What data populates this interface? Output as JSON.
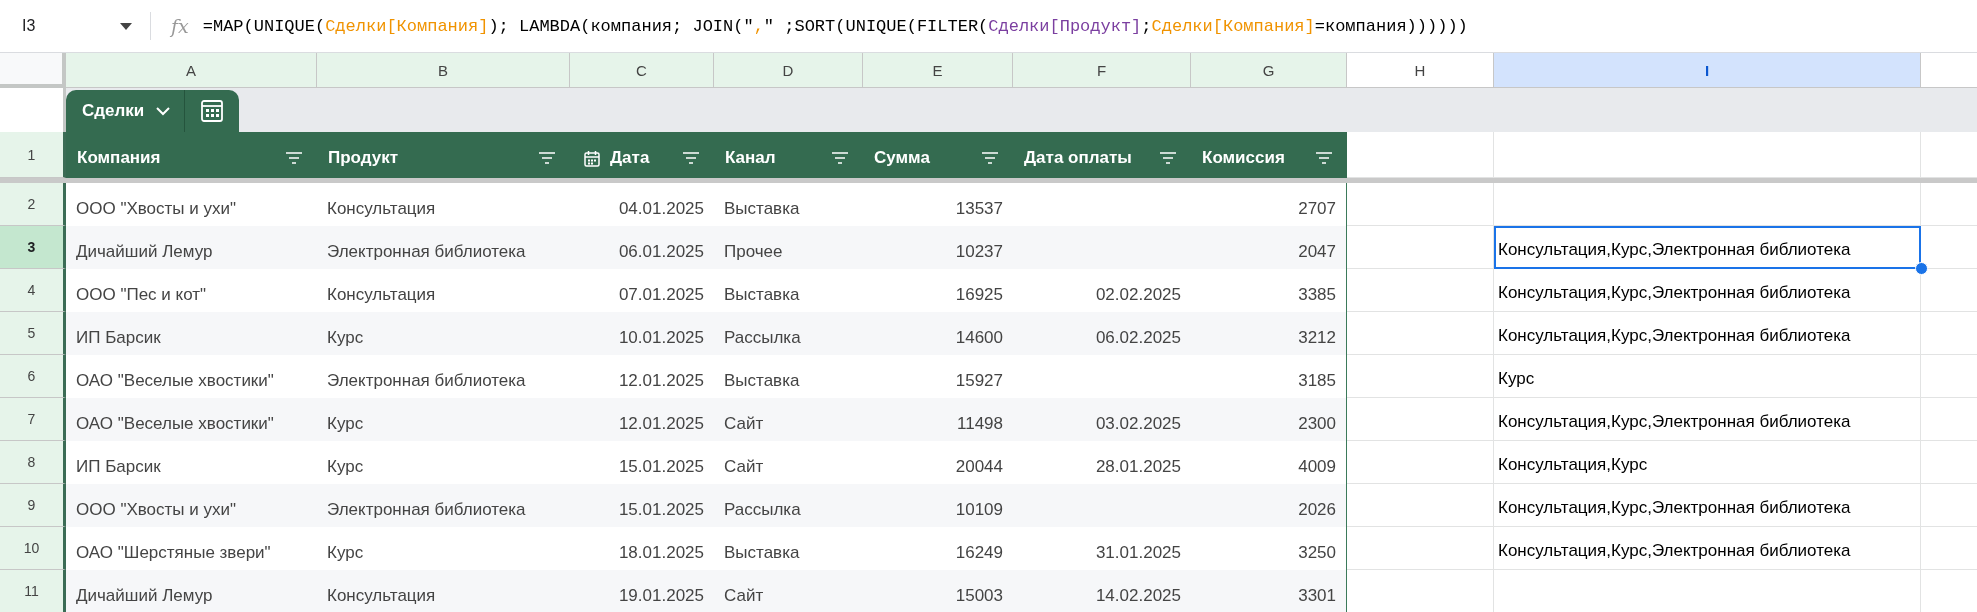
{
  "formula_bar": {
    "cell_ref": "I3",
    "fx": "fx",
    "formula": [
      {
        "text": "=MAP(UNIQUE(",
        "color": "#000000"
      },
      {
        "text": "Сделки[Компания]",
        "color": "#f09300"
      },
      {
        "text": "); LAMBDA(компания; JOIN(\"",
        "color": "#000000"
      },
      {
        "text": ",",
        "color": "#f09300"
      },
      {
        "text": "\" ;SORT(UNIQUE(FILTER(",
        "color": "#000000"
      },
      {
        "text": "Сделки[Продукт]",
        "color": "#7b3fa0"
      },
      {
        "text": ";",
        "color": "#000000"
      },
      {
        "text": "Сделки[Компания]",
        "color": "#f09300"
      },
      {
        "text": "=компания))))))",
        "color": "#000000"
      }
    ]
  },
  "columns": [
    {
      "label": "A",
      "in_table": true,
      "selected": false
    },
    {
      "label": "B",
      "in_table": true,
      "selected": false
    },
    {
      "label": "C",
      "in_table": true,
      "selected": false
    },
    {
      "label": "D",
      "in_table": true,
      "selected": false
    },
    {
      "label": "E",
      "in_table": true,
      "selected": false
    },
    {
      "label": "F",
      "in_table": true,
      "selected": false
    },
    {
      "label": "G",
      "in_table": true,
      "selected": false
    },
    {
      "label": "H",
      "in_table": false,
      "selected": false
    },
    {
      "label": "I",
      "in_table": false,
      "selected": true
    }
  ],
  "table": {
    "name": "Сделки",
    "header_row": "1",
    "header_selected": false,
    "fields": [
      {
        "label": "Компания",
        "kind": "text"
      },
      {
        "label": "Продукт",
        "kind": "text"
      },
      {
        "label": "Дата",
        "kind": "date"
      },
      {
        "label": "Канал",
        "kind": "text"
      },
      {
        "label": "Сумма",
        "kind": "number"
      },
      {
        "label": "Дата оплаты",
        "kind": "number"
      },
      {
        "label": "Комиссия",
        "kind": "number"
      }
    ]
  },
  "rows": [
    {
      "num": "2",
      "selected": false,
      "cells": [
        "ООО \"Хвосты и ухи\"",
        "Консультация",
        "04.01.2025",
        "Выставка",
        "13537",
        "",
        "2707"
      ]
    },
    {
      "num": "3",
      "selected": true,
      "cells": [
        "Дичайший Лемур",
        "Электронная библиотека",
        "06.01.2025",
        "Прочее",
        "10237",
        "",
        "2047"
      ],
      "result": "Консультация,Курс,Электронная библиотека"
    },
    {
      "num": "4",
      "selected": false,
      "cells": [
        "ООО \"Пес и кот\"",
        "Консультация",
        "07.01.2025",
        "Выставка",
        "16925",
        "02.02.2025",
        "3385"
      ],
      "result": "Консультация,Курс,Электронная библиотека"
    },
    {
      "num": "5",
      "selected": false,
      "cells": [
        "ИП Барсик",
        "Курс",
        "10.01.2025",
        "Рассылка",
        "14600",
        "06.02.2025",
        "3212"
      ],
      "result": "Консультация,Курс,Электронная библиотека"
    },
    {
      "num": "6",
      "selected": false,
      "cells": [
        "ОАО \"Веселые хвостики\"",
        "Электронная библиотека",
        "12.01.2025",
        "Выставка",
        "15927",
        "",
        "3185"
      ],
      "result": "Курс"
    },
    {
      "num": "7",
      "selected": false,
      "cells": [
        "ОАО \"Веселые хвостики\"",
        "Курс",
        "12.01.2025",
        "Сайт",
        "11498",
        "03.02.2025",
        "2300"
      ],
      "result": "Консультация,Курс,Электронная библиотека"
    },
    {
      "num": "8",
      "selected": false,
      "cells": [
        "ИП Барсик",
        "Курс",
        "15.01.2025",
        "Сайт",
        "20044",
        "28.01.2025",
        "4009"
      ],
      "result": "Консультация,Курс"
    },
    {
      "num": "9",
      "selected": false,
      "cells": [
        "ООО \"Хвосты и ухи\"",
        "Электронная библиотека",
        "15.01.2025",
        "Рассылка",
        "10109",
        "",
        "2026"
      ],
      "result": "Консультация,Курс,Электронная библиотека"
    },
    {
      "num": "10",
      "selected": false,
      "cells": [
        "ОАО \"Шерстяные звери\"",
        "Курс",
        "18.01.2025",
        "Выставка",
        "16249",
        "31.01.2025",
        "3250"
      ],
      "result": "Консультация,Курс,Электронная библиотека"
    },
    {
      "num": "11",
      "selected": false,
      "cells": [
        "Дичайший Лемур",
        "Консультация",
        "19.01.2025",
        "Сайт",
        "15003",
        "14.02.2025",
        "3301"
      ]
    }
  ]
}
